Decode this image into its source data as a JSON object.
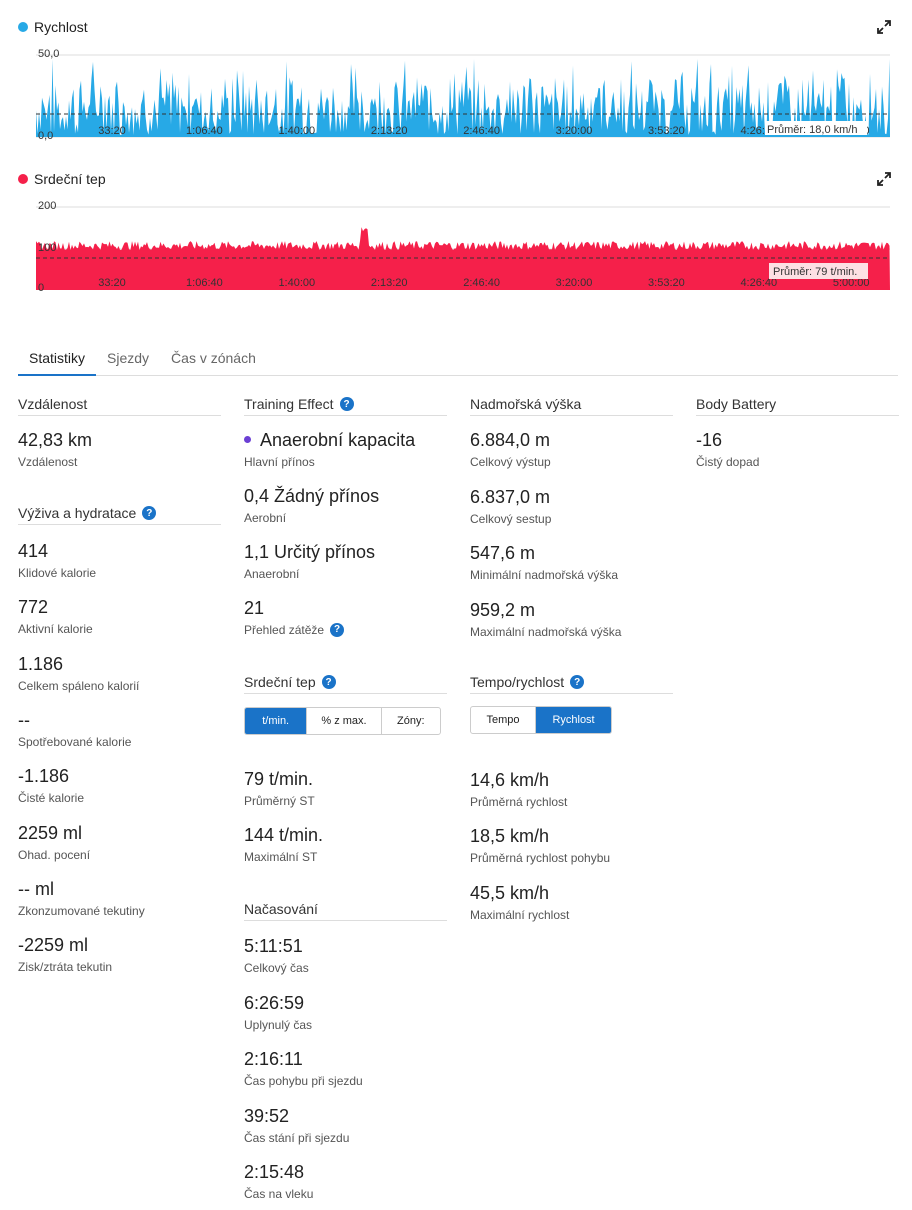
{
  "colors": {
    "speed": "#27a9e6",
    "heart": "#f5204a",
    "accent": "#1a73c8",
    "te_dot": "#6b3fd4"
  },
  "speed_chart": {
    "title": "Rychlost",
    "ytick_top": "50,0",
    "ytick_bottom": "0,0",
    "xticks": [
      "33:20",
      "1:06:40",
      "1:40:00",
      "2:13:20",
      "2:46:40",
      "3:20:00",
      "3:53:20",
      "4:26:40",
      "5:00:00"
    ],
    "avg_label": "Průměr: 18,0 km/h",
    "expand_icon": "expand-icon"
  },
  "heart_chart": {
    "title": "Srdeční tep",
    "ytick_top": "200",
    "ytick_mid": "100",
    "ytick_bottom": "0",
    "xticks": [
      "33:20",
      "1:06:40",
      "1:40:00",
      "2:13:20",
      "2:46:40",
      "3:20:00",
      "3:53:20",
      "4:26:40",
      "5:00:00"
    ],
    "avg_label": "Průměr: 79 t/min.",
    "expand_icon": "expand-icon"
  },
  "chart_data": [
    {
      "type": "area",
      "title": "Rychlost",
      "ylim": [
        0,
        50
      ],
      "x": [
        "33:20",
        "1:06:40",
        "1:40:00",
        "2:13:20",
        "2:46:40",
        "3:20:00",
        "3:53:20",
        "4:26:40",
        "5:00:00"
      ],
      "average": 18.0,
      "unit": "km/h",
      "grid": true
    },
    {
      "type": "area",
      "title": "Srdeční tep",
      "ylim": [
        0,
        200
      ],
      "x": [
        "33:20",
        "1:06:40",
        "1:40:00",
        "2:13:20",
        "2:46:40",
        "3:20:00",
        "3:53:20",
        "4:26:40",
        "5:00:00"
      ],
      "average": 79,
      "unit": "t/min.",
      "grid": true
    }
  ],
  "tabs": [
    "Statistiky",
    "Sjezdy",
    "Čas v zónách"
  ],
  "col1": {
    "distance": {
      "title": "Vzdálenost",
      "value": "42,83 km",
      "label": "Vzdálenost"
    },
    "nutrition": {
      "title": "Výživa a hydratace",
      "items": [
        {
          "value": "414",
          "label": "Klidové kalorie"
        },
        {
          "value": "772",
          "label": "Aktivní kalorie"
        },
        {
          "value": "1.186",
          "label": "Celkem spáleno kalorií"
        },
        {
          "value": "--",
          "label": "Spotřebované kalorie"
        },
        {
          "value": "-1.186",
          "label": "Čisté kalorie"
        },
        {
          "value": "2259 ml",
          "label": "Ohad. pocení"
        },
        {
          "value": "-- ml",
          "label": "Zkonzumované tekutiny"
        },
        {
          "value": "-2259 ml",
          "label": "Zisk/ztráta tekutin"
        }
      ]
    }
  },
  "col2": {
    "te": {
      "title": "Training Effect",
      "main_value": "Anaerobní kapacita",
      "main_label": "Hlavní přínos",
      "items": [
        {
          "value": "0,4 Žádný přínos",
          "label": "Aerobní"
        },
        {
          "value": "1,1 Určitý přínos",
          "label": "Anaerobní"
        },
        {
          "value": "21",
          "label": "Přehled zátěže"
        }
      ]
    },
    "hr": {
      "title": "Srdeční tep",
      "toggle": [
        "t/min.",
        "% z max.",
        "Zóny:"
      ],
      "items": [
        {
          "value": "79 t/min.",
          "label": "Průměrný ST"
        },
        {
          "value": "144 t/min.",
          "label": "Maximální ST"
        }
      ]
    },
    "timing": {
      "title": "Načasování",
      "items": [
        {
          "value": "5:11:51",
          "label": "Celkový čas"
        },
        {
          "value": "6:26:59",
          "label": "Uplynulý čas"
        },
        {
          "value": "2:16:11",
          "label": "Čas pohybu při sjezdu"
        },
        {
          "value": "39:52",
          "label": "Čas stání při sjezdu"
        },
        {
          "value": "2:15:48",
          "label": "Čas na vleku"
        }
      ]
    }
  },
  "col3": {
    "elev": {
      "title": "Nadmořská výška",
      "items": [
        {
          "value": "6.884,0 m",
          "label": "Celkový výstup"
        },
        {
          "value": "6.837,0 m",
          "label": "Celkový sestup"
        },
        {
          "value": "547,6 m",
          "label": "Minimální nadmořská výška"
        },
        {
          "value": "959,2 m",
          "label": "Maximální nadmořská výška"
        }
      ]
    },
    "pace": {
      "title": "Tempo/rychlost",
      "toggle": [
        "Tempo",
        "Rychlost"
      ],
      "items": [
        {
          "value": "14,6 km/h",
          "label": "Průměrná rychlost"
        },
        {
          "value": "18,5 km/h",
          "label": "Průměrná rychlost pohybu"
        },
        {
          "value": "45,5 km/h",
          "label": "Maximální rychlost"
        }
      ]
    }
  },
  "col4": {
    "bb": {
      "title": "Body Battery",
      "value": "-16",
      "label": "Čistý dopad"
    }
  },
  "help_icon": "?"
}
